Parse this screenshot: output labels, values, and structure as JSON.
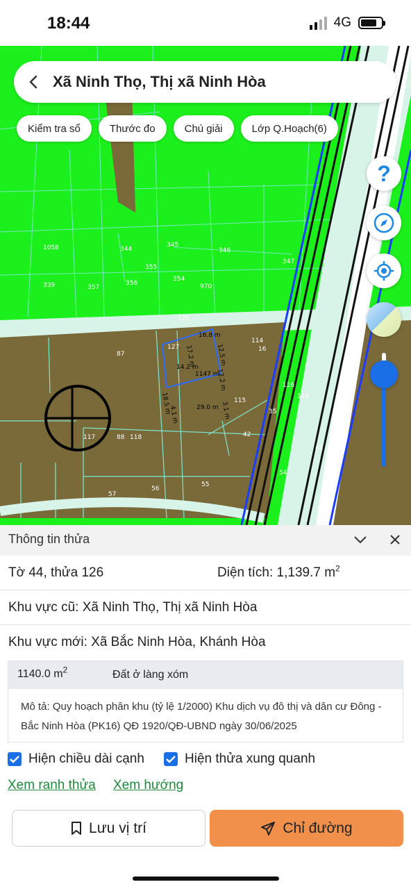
{
  "status": {
    "time": "18:44",
    "network": "4G"
  },
  "header": {
    "title": "Xã Ninh Thọ, Thị xã Ninh Hòa"
  },
  "chips": [
    "Kiểm tra sổ",
    "Thước đo",
    "Chú giải",
    "Lớp Q.Hoạch(6)"
  ],
  "map_controls": {
    "help_label": "?"
  },
  "map": {
    "parcel_labels": [
      "1058",
      "344",
      "345",
      "346",
      "347",
      "339",
      "357",
      "356",
      "355",
      "354",
      "970",
      "125",
      "114",
      "16",
      "87",
      "127",
      "115",
      "116",
      "119",
      "117",
      "88",
      "118",
      "42",
      "35",
      "41",
      "54",
      "57",
      "56",
      "55"
    ],
    "measurements": [
      "16.8 m",
      "12.5 m",
      "17.2 m",
      "14.2 m",
      "1147 m",
      "12.2 m",
      "18.5 m",
      "4.1 m",
      "29.0 m",
      "3.1 m"
    ]
  },
  "panel": {
    "title": "Thông tin thửa",
    "sheet_parcel": "Tờ 44, thửa 126",
    "area_label": "Diện tích: 1,139.7 m",
    "area_sup": "2",
    "old_area": "Khu vực cũ: Xã Ninh Thọ, Thị xã Ninh Hòa",
    "new_area": "Khu vực mới: Xã Bắc Ninh Hòa, Khánh Hòa",
    "detail": {
      "area": "1140.0 m",
      "area_sup": "2",
      "land_type": "Đất ở làng xóm",
      "description": "Mô tả: Quy hoạch phân khu (tỷ lệ 1/2000) Khu dịch vụ đô thị và dân cư Đông - Bắc Ninh Hòa (PK16) QĐ 1920/QĐ-UBND ngày 30/06/2025"
    },
    "checkbox_edge_length": "Hiện chiều dài cạnh",
    "checkbox_neighbors": "Hiện thửa xung quanh",
    "link_boundary": "Xem ranh thửa",
    "link_direction": "Xem hướng",
    "btn_save": "Lưu vị trí",
    "btn_direction": "Chỉ đường"
  },
  "colors": {
    "map_green": "#1cf01c",
    "parcel_brown": "#7a6a3a",
    "accent_blue": "#1a6fe6",
    "button_orange": "#f0904a",
    "link_green": "#1e8a3a"
  }
}
